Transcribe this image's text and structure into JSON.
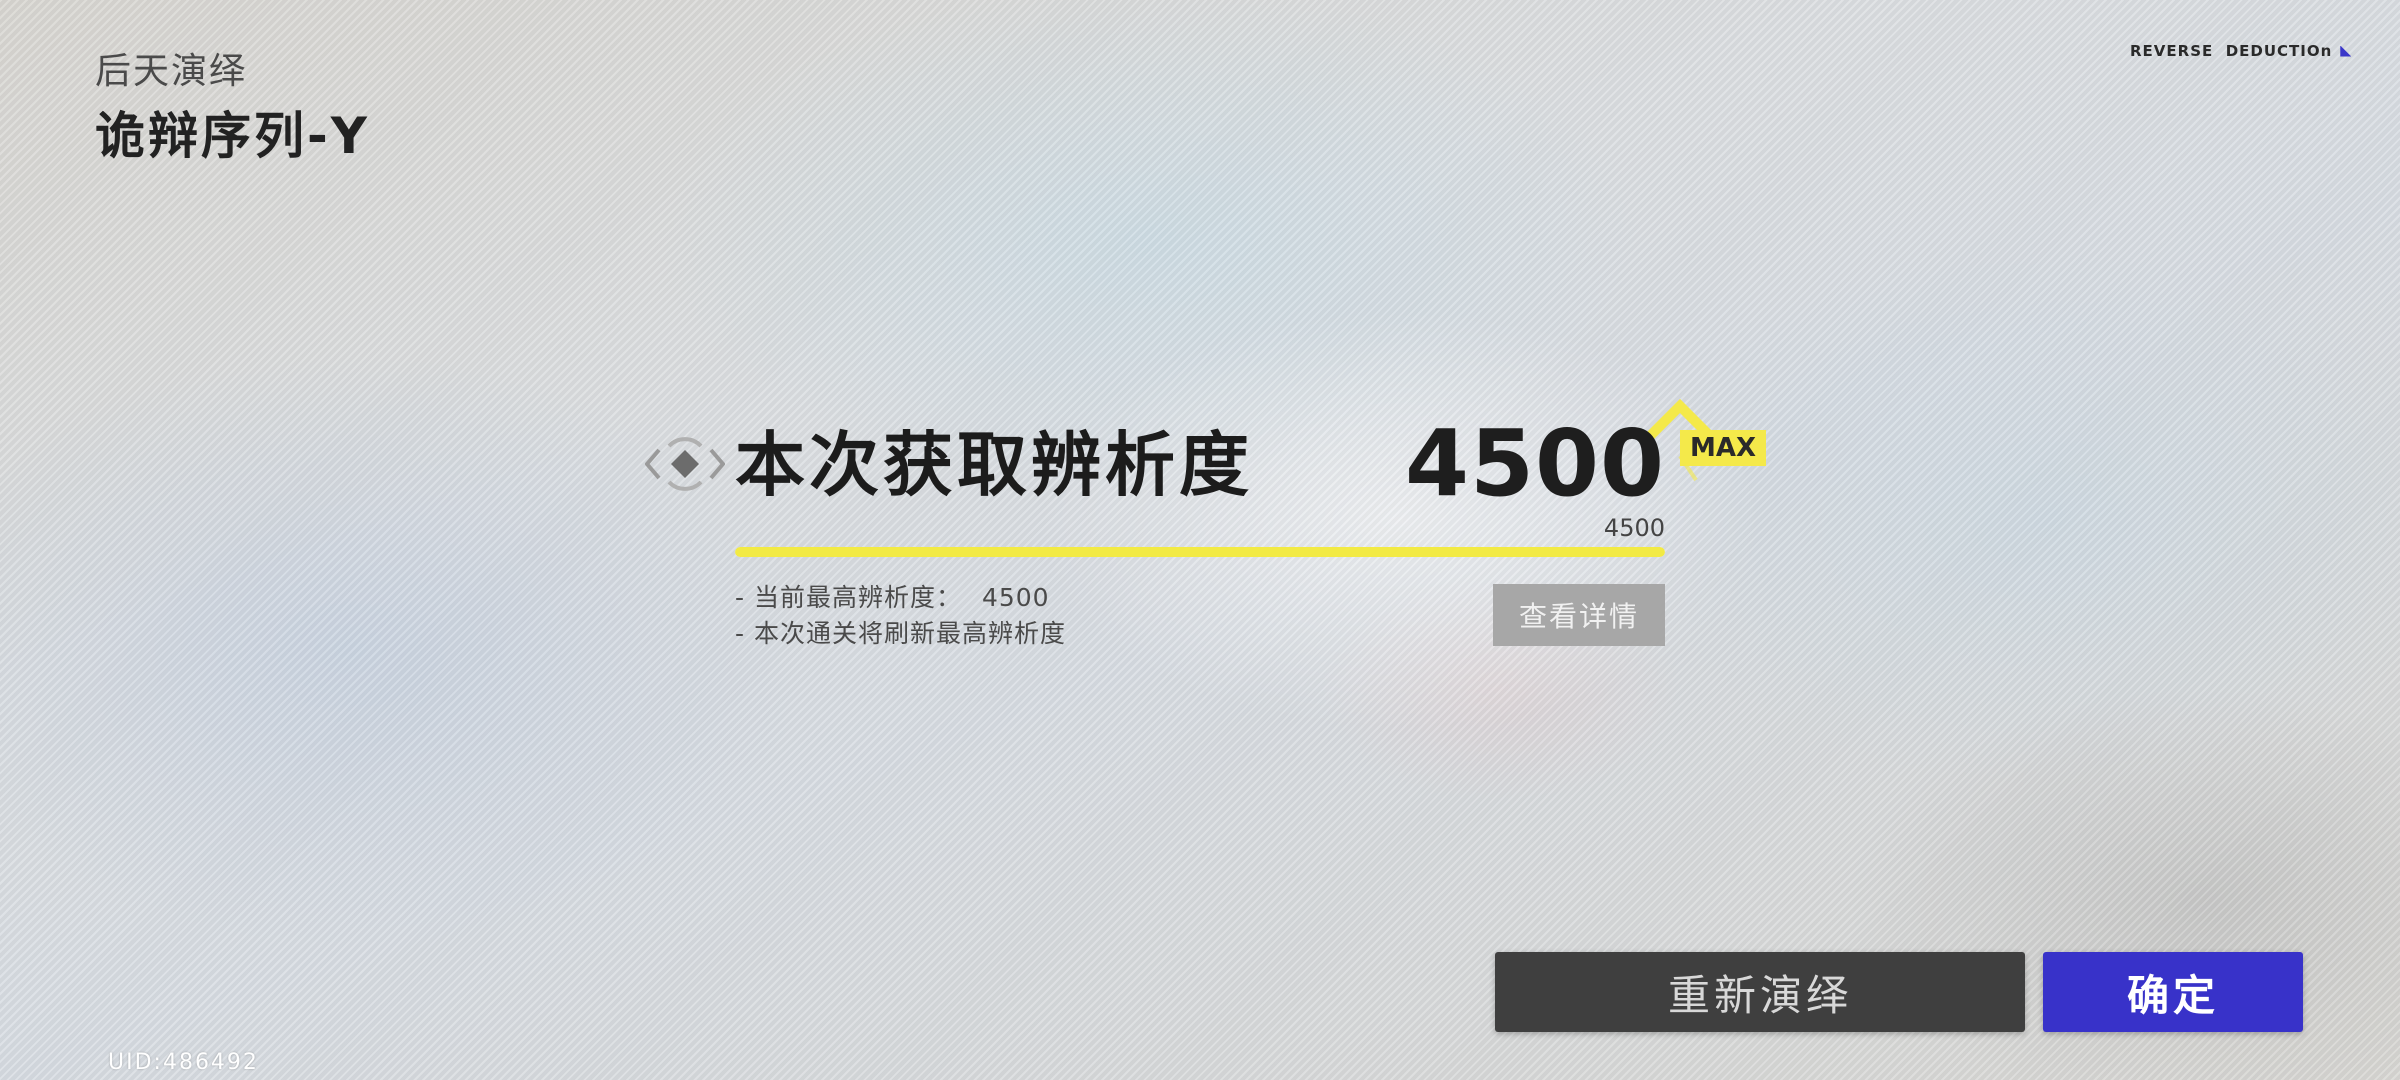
{
  "header": {
    "mode_label": "后天演绎",
    "stage_title": "诡辩序列-Y",
    "brand": "REVERSE  DEDUCTIOn"
  },
  "result": {
    "title": "本次获取辨析度",
    "score": "4500",
    "score_sub": "4500",
    "max_label": "MAX",
    "progress_fraction": 1.0,
    "info_line_1": "- 当前最高辨析度：",
    "info_line_1_value": "4500",
    "info_line_2": "- 本次通关将刷新最高辨析度",
    "details_button": "查看详情"
  },
  "actions": {
    "retry": "重新演绎",
    "confirm": "确定"
  },
  "footer": {
    "uid": "UID:486492"
  },
  "colors": {
    "accent_yellow": "#f2ea44",
    "confirm_blue": "#3832c9",
    "retry_dark": "#3f3f3f"
  }
}
